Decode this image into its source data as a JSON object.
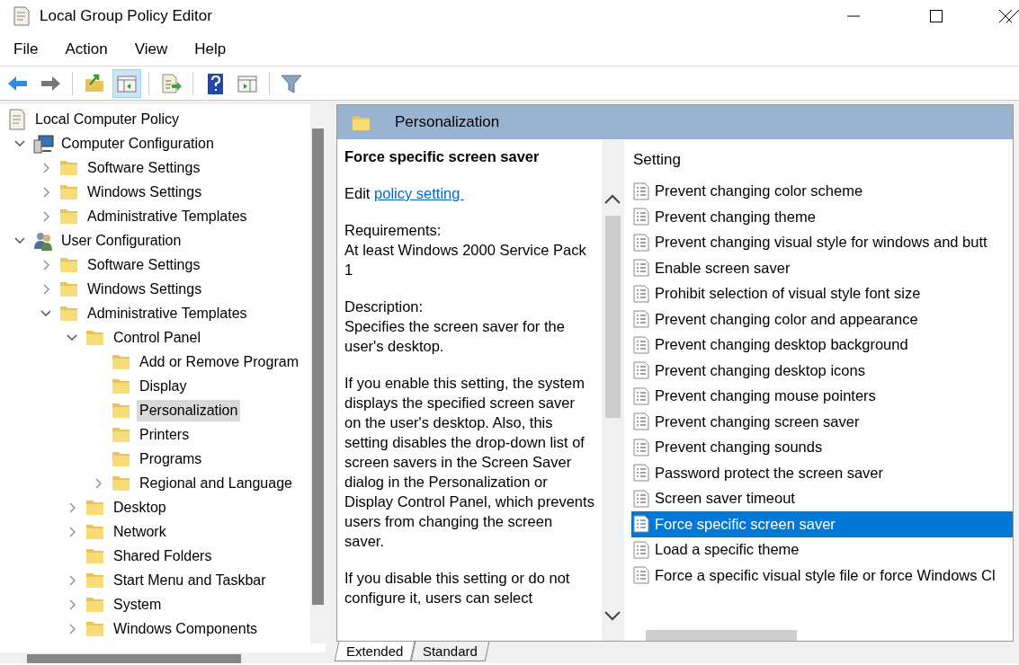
{
  "window": {
    "title": "Local Group Policy Editor"
  },
  "menu": [
    "File",
    "Action",
    "View",
    "Help"
  ],
  "toolbar": [
    {
      "kind": "back",
      "selected": false
    },
    {
      "kind": "forward",
      "selected": false
    },
    {
      "kind": "up",
      "selected": false
    },
    {
      "kind": "tree",
      "selected": true
    },
    {
      "kind": "export",
      "selected": false
    },
    {
      "kind": "help",
      "selected": false
    },
    {
      "kind": "pane",
      "selected": false
    },
    {
      "kind": "filter",
      "selected": false
    }
  ],
  "tree": [
    {
      "label": "Local Computer Policy",
      "kind": "root",
      "selected": false,
      "children": [
        {
          "label": "Computer Configuration",
          "kind": "computer",
          "expanded": true,
          "selected": false,
          "children": [
            {
              "label": "Software Settings",
              "kind": "folder",
              "expanded": false,
              "selected": false
            },
            {
              "label": "Windows Settings",
              "kind": "folder",
              "expanded": false,
              "selected": false
            },
            {
              "label": "Administrative Templates",
              "kind": "folder",
              "expanded": false,
              "selected": false
            }
          ]
        },
        {
          "label": "User Configuration",
          "kind": "user",
          "expanded": true,
          "selected": false,
          "children": [
            {
              "label": "Software Settings",
              "kind": "folder",
              "expanded": false,
              "selected": false
            },
            {
              "label": "Windows Settings",
              "kind": "folder",
              "expanded": false,
              "selected": false
            },
            {
              "label": "Administrative Templates",
              "kind": "folder",
              "expanded": true,
              "selected": false,
              "children": [
                {
                  "label": "Control Panel",
                  "kind": "folder",
                  "expanded": true,
                  "selected": false,
                  "children": [
                    {
                      "label": "Add or Remove Program",
                      "kind": "folder",
                      "selected": false
                    },
                    {
                      "label": "Display",
                      "kind": "folder",
                      "selected": false
                    },
                    {
                      "label": "Personalization",
                      "kind": "folder",
                      "selected": true
                    },
                    {
                      "label": "Printers",
                      "kind": "folder",
                      "selected": false
                    },
                    {
                      "label": "Programs",
                      "kind": "folder",
                      "selected": false
                    },
                    {
                      "label": "Regional and Language",
                      "kind": "folder",
                      "expanded": false,
                      "selected": false
                    }
                  ]
                },
                {
                  "label": "Desktop",
                  "kind": "folder",
                  "expanded": false,
                  "selected": false
                },
                {
                  "label": "Network",
                  "kind": "folder",
                  "expanded": false,
                  "selected": false
                },
                {
                  "label": "Shared Folders",
                  "kind": "folder",
                  "selected": false
                },
                {
                  "label": "Start Menu and Taskbar",
                  "kind": "folder",
                  "expanded": false,
                  "selected": false
                },
                {
                  "label": "System",
                  "kind": "folder",
                  "expanded": false,
                  "selected": false
                },
                {
                  "label": "Windows Components",
                  "kind": "folder",
                  "expanded": false,
                  "selected": false
                }
              ]
            }
          ]
        }
      ]
    }
  ],
  "pane": {
    "title": "Personalization",
    "description": {
      "heading": "Force specific screen saver",
      "edit_prefix": "Edit",
      "edit_link": "policy setting ",
      "paragraphs": [
        "Requirements:\nAt least Windows 2000 Service Pack 1",
        "Description:\nSpecifies the screen saver for the user's desktop.",
        "If you enable this setting, the system displays the specified screen saver on the user's desktop. Also, this setting disables the drop-down list of screen savers in the Screen Saver dialog in the Personalization or Display Control Panel, which prevents users from changing the screen saver.",
        "If you disable this setting or do not configure it, users can select"
      ]
    },
    "column": "Setting",
    "settings": [
      {
        "label": "Prevent changing color scheme",
        "selected": false
      },
      {
        "label": "Prevent changing theme",
        "selected": false
      },
      {
        "label": "Prevent changing visual style for windows and butt",
        "selected": false
      },
      {
        "label": "Enable screen saver",
        "selected": false
      },
      {
        "label": "Prohibit selection of visual style font size",
        "selected": false
      },
      {
        "label": "Prevent changing color and appearance",
        "selected": false
      },
      {
        "label": "Prevent changing desktop background",
        "selected": false
      },
      {
        "label": "Prevent changing desktop icons",
        "selected": false
      },
      {
        "label": "Prevent changing mouse pointers",
        "selected": false
      },
      {
        "label": "Prevent changing screen saver",
        "selected": false
      },
      {
        "label": "Prevent changing sounds",
        "selected": false
      },
      {
        "label": "Password protect the screen saver",
        "selected": false
      },
      {
        "label": "Screen saver timeout",
        "selected": false
      },
      {
        "label": "Force specific screen saver",
        "selected": true
      },
      {
        "label": "Load a specific theme",
        "selected": false
      },
      {
        "label": "Force a specific visual style file or force Windows Cl",
        "selected": false
      }
    ],
    "tabs": [
      {
        "label": "Extended",
        "selected": true
      },
      {
        "label": "Standard",
        "selected": false
      }
    ]
  }
}
